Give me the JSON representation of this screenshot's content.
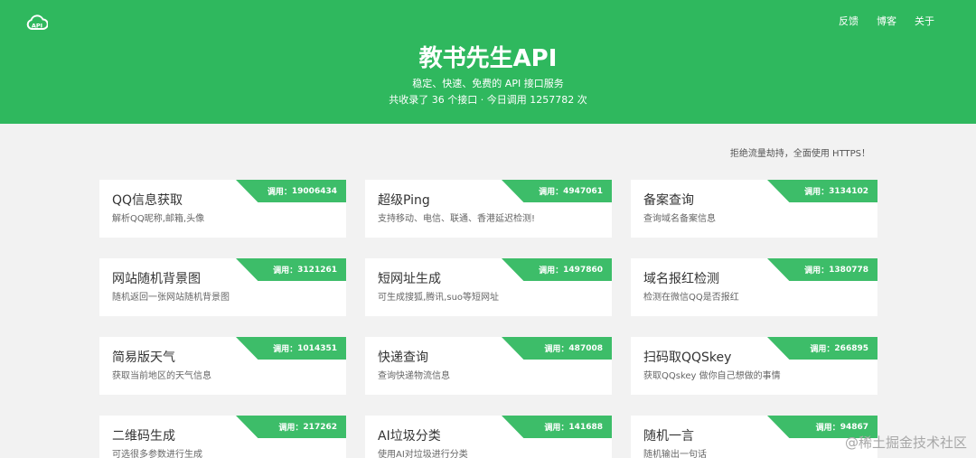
{
  "header": {
    "logo_text": "API",
    "title": "教书先生API",
    "subtitle": "稳定、快速、免费的 API 接口服务",
    "stats": "共收录了 36 个接口 · 今日调用 1257782 次",
    "nav": [
      {
        "label": "反馈"
      },
      {
        "label": "博客"
      },
      {
        "label": "关于"
      }
    ]
  },
  "notice": "拒绝流量劫持，全面使用 HTTPS！",
  "badge_label": "调用：",
  "cards": [
    {
      "title": "QQ信息获取",
      "desc": "解析QQ昵称,邮箱,头像",
      "count": "19006434"
    },
    {
      "title": "超级Ping",
      "desc": "支持移动、电信、联通、香港延迟检测!",
      "count": "4947061"
    },
    {
      "title": "备案查询",
      "desc": "查询域名备案信息",
      "count": "3134102"
    },
    {
      "title": "网站随机背景图",
      "desc": "随机返回一张网站随机背景图",
      "count": "3121261"
    },
    {
      "title": "短网址生成",
      "desc": "可生成搜狐,腾讯,suo等短网址",
      "count": "1497860"
    },
    {
      "title": "域名报红检测",
      "desc": "检测在微信QQ是否报红",
      "count": "1380778"
    },
    {
      "title": "简易版天气",
      "desc": "获取当前地区的天气信息",
      "count": "1014351"
    },
    {
      "title": "快递查询",
      "desc": "查询快递物流信息",
      "count": "487008"
    },
    {
      "title": "扫码取QQSkey",
      "desc": "获取QQskey 做你自己想做的事情",
      "count": "266895"
    },
    {
      "title": "二维码生成",
      "desc": "可选很多参数进行生成",
      "count": "217262"
    },
    {
      "title": "AI垃圾分类",
      "desc": "使用AI对垃圾进行分类",
      "count": "141688"
    },
    {
      "title": "随机一言",
      "desc": "随机输出一句话",
      "count": "94867"
    }
  ],
  "watermark": "@稀土掘金技术社区"
}
